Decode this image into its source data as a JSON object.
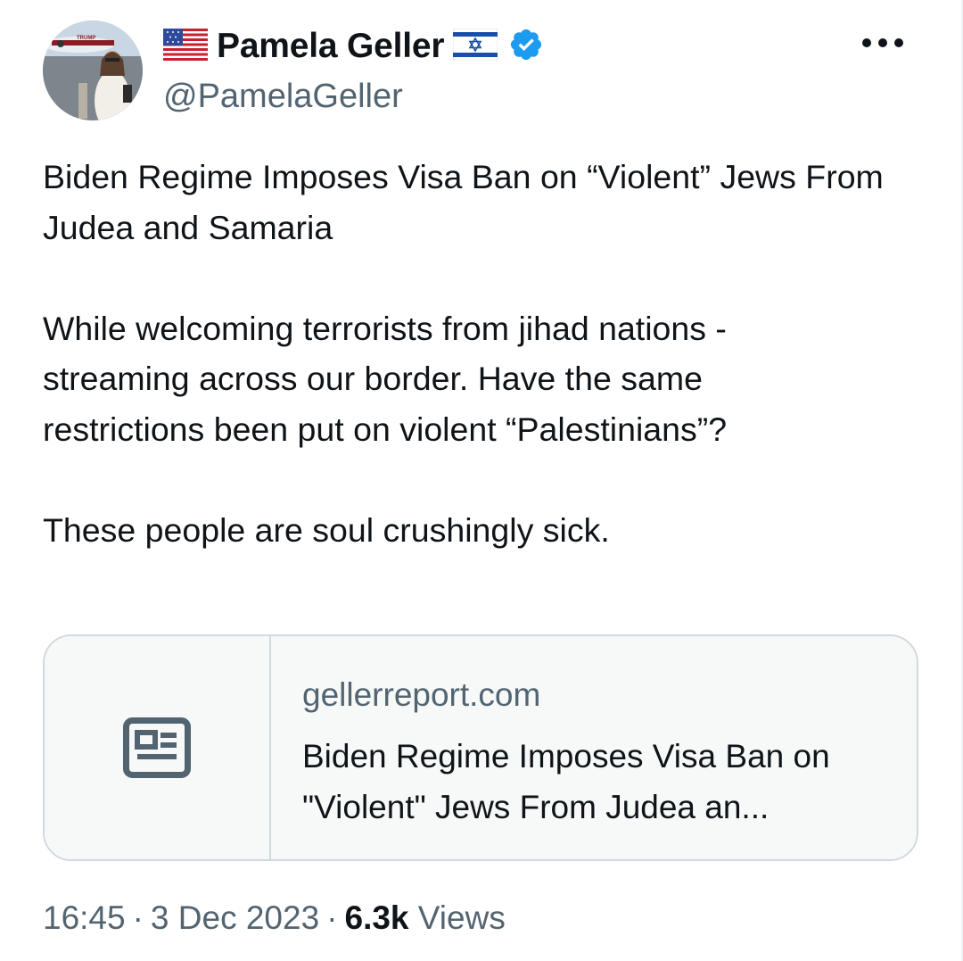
{
  "author": {
    "display_name": "Pamela Geller",
    "handle": "@PamelaGeller",
    "avatar_plane_text": "TRUMP",
    "verified": true,
    "flags": [
      "us-flag-emoji",
      "israel-flag-emoji"
    ],
    "verified_color": "#1d9bf0"
  },
  "tweet": {
    "paragraphs": [
      "Biden Regime Imposes Visa Ban on “Violent” Jews From Judea and Samaria",
      "While welcoming terrorists from jihad nations - streaming across our border.  Have the same restrictions been put on violent “Palestinians”?",
      "These people are soul crushingly sick."
    ]
  },
  "link_card": {
    "icon": "news-article-icon",
    "domain": "gellerreport.com",
    "title": "Biden Regime Imposes Visa Ban on \"Violent\" Jews From Judea an..."
  },
  "meta": {
    "time": "16:45",
    "separator": "·",
    "date": "3 Dec 2023",
    "views_count": "6.3k",
    "views_label": "Views"
  },
  "colors": {
    "text_primary": "#0f1419",
    "text_secondary": "#536471",
    "border": "#cfd9de",
    "card_bg": "#f7f9f9"
  }
}
